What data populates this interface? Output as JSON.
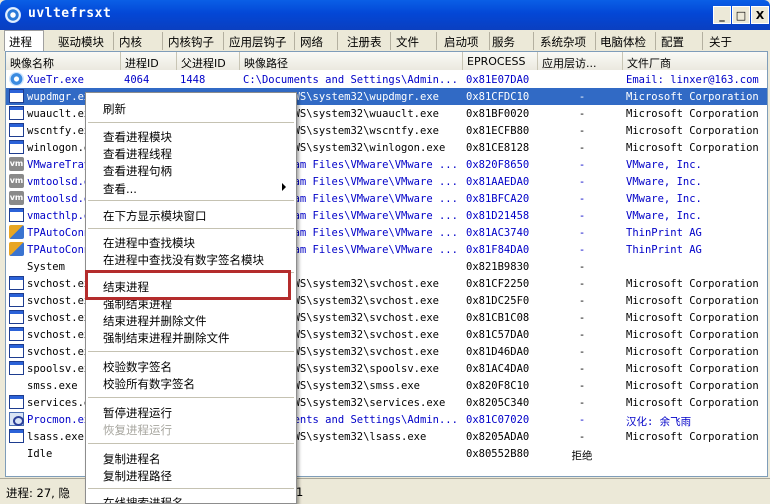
{
  "window": {
    "title": "uvltefrsxt",
    "minimize_label": "_",
    "maximize_label": "□",
    "close_label": "X"
  },
  "tabs": [
    "进程",
    "驱动模块",
    "内核",
    "内核钩子",
    "应用层钩子",
    "网络",
    "注册表",
    "文件",
    "启动项",
    "服务",
    "系统杂项",
    "电脑体检",
    "配置",
    "关于"
  ],
  "table": {
    "columns": [
      "映像名称",
      "进程ID",
      "父进程ID",
      "映像路径",
      "EPROCESS",
      "应用层访...",
      "文件厂商"
    ],
    "rows": [
      {
        "name": "XueTr.exe",
        "pid": "4064",
        "ppid": "1448",
        "path": "C:\\Documents and Settings\\Admin...",
        "eprocess": "0x81E07DA0",
        "access": "",
        "vendor": "Email: linxer@163.com",
        "icon": "xuetr-icon",
        "blue": true,
        "selected": false
      },
      {
        "name": "wupdmgr.exe",
        "pid": "",
        "ppid": "",
        "path": "C:\\WINDOWS\\system32\\wupdmgr.exe",
        "eprocess": "0x81CFDC10",
        "access": "-",
        "vendor": "Microsoft Corporation",
        "icon": "window-icon",
        "blue": false,
        "selected": true
      },
      {
        "name": "wuauclt.exe",
        "pid": "",
        "ppid": "",
        "path": "C:\\WINDOWS\\system32\\wuauclt.exe",
        "eprocess": "0x81BF0020",
        "access": "-",
        "vendor": "Microsoft Corporation",
        "icon": "window-icon",
        "blue": false,
        "selected": false
      },
      {
        "name": "wscntfy.exe",
        "pid": "",
        "ppid": "",
        "path": "C:\\WINDOWS\\system32\\wscntfy.exe",
        "eprocess": "0x81ECFB80",
        "access": "-",
        "vendor": "Microsoft Corporation",
        "icon": "window-icon",
        "blue": false,
        "selected": false
      },
      {
        "name": "winlogon.exe",
        "pid": "",
        "ppid": "",
        "path": "C:\\WINDOWS\\system32\\winlogon.exe",
        "eprocess": "0x81CE8128",
        "access": "-",
        "vendor": "Microsoft Corporation",
        "icon": "window-icon",
        "blue": false,
        "selected": false
      },
      {
        "name": "VMwareTray.exe",
        "pid": "",
        "ppid": "",
        "path": "C:\\Program Files\\VMware\\VMware ...",
        "eprocess": "0x820F8650",
        "access": "-",
        "vendor": "VMware, Inc.",
        "icon": "vm-icon",
        "blue": true,
        "selected": false
      },
      {
        "name": "vmtoolsd.exe",
        "pid": "",
        "ppid": "",
        "path": "C:\\Program Files\\VMware\\VMware ...",
        "eprocess": "0x81AAEDA0",
        "access": "-",
        "vendor": "VMware, Inc.",
        "icon": "vm-icon",
        "blue": true,
        "selected": false
      },
      {
        "name": "vmtoolsd.exe",
        "pid": "",
        "ppid": "",
        "path": "C:\\Program Files\\VMware\\VMware ...",
        "eprocess": "0x81BFCA20",
        "access": "-",
        "vendor": "VMware, Inc.",
        "icon": "vm-icon",
        "blue": true,
        "selected": false
      },
      {
        "name": "vmacthlp.exe",
        "pid": "",
        "ppid": "",
        "path": "C:\\Program Files\\VMware\\VMware ...",
        "eprocess": "0x81D21458",
        "access": "-",
        "vendor": "VMware, Inc.",
        "icon": "window-icon",
        "blue": true,
        "selected": false
      },
      {
        "name": "TPAutoConnSvc.exe",
        "pid": "",
        "ppid": "",
        "path": "C:\\Program Files\\VMware\\VMware ...",
        "eprocess": "0x81AC3740",
        "access": "-",
        "vendor": "ThinPrint AG",
        "icon": "thinprint-icon",
        "blue": true,
        "selected": false
      },
      {
        "name": "TPAutoConnect.exe",
        "pid": "",
        "ppid": "",
        "path": "C:\\Program Files\\VMware\\VMware ...",
        "eprocess": "0x81F84DA0",
        "access": "-",
        "vendor": "ThinPrint AG",
        "icon": "thinprint-icon",
        "blue": true,
        "selected": false
      },
      {
        "name": "System",
        "pid": "",
        "ppid": "",
        "path": "",
        "eprocess": "0x821B9830",
        "access": "-",
        "vendor": "",
        "icon": "blank-icon",
        "blue": false,
        "selected": false
      },
      {
        "name": "svchost.exe",
        "pid": "",
        "ppid": "",
        "path": "C:\\WINDOWS\\system32\\svchost.exe",
        "eprocess": "0x81CF2250",
        "access": "-",
        "vendor": "Microsoft Corporation",
        "icon": "window-icon",
        "blue": false,
        "selected": false
      },
      {
        "name": "svchost.exe",
        "pid": "",
        "ppid": "",
        "path": "C:\\WINDOWS\\system32\\svchost.exe",
        "eprocess": "0x81DC25F0",
        "access": "-",
        "vendor": "Microsoft Corporation",
        "icon": "window-icon",
        "blue": false,
        "selected": false
      },
      {
        "name": "svchost.exe",
        "pid": "",
        "ppid": "",
        "path": "C:\\WINDOWS\\system32\\svchost.exe",
        "eprocess": "0x81CB1C08",
        "access": "-",
        "vendor": "Microsoft Corporation",
        "icon": "window-icon",
        "blue": false,
        "selected": false
      },
      {
        "name": "svchost.exe",
        "pid": "",
        "ppid": "",
        "path": "C:\\WINDOWS\\system32\\svchost.exe",
        "eprocess": "0x81C57DA0",
        "access": "-",
        "vendor": "Microsoft Corporation",
        "icon": "window-icon",
        "blue": false,
        "selected": false
      },
      {
        "name": "svchost.exe",
        "pid": "",
        "ppid": "",
        "path": "C:\\WINDOWS\\system32\\svchost.exe",
        "eprocess": "0x81D46DA0",
        "access": "-",
        "vendor": "Microsoft Corporation",
        "icon": "window-icon",
        "blue": false,
        "selected": false
      },
      {
        "name": "spoolsv.exe",
        "pid": "",
        "ppid": "",
        "path": "C:\\WINDOWS\\system32\\spoolsv.exe",
        "eprocess": "0x81AC4DA0",
        "access": "-",
        "vendor": "Microsoft Corporation",
        "icon": "window-icon",
        "blue": false,
        "selected": false
      },
      {
        "name": "smss.exe",
        "pid": "",
        "ppid": "",
        "path": "C:\\WINDOWS\\system32\\smss.exe",
        "eprocess": "0x820F8C10",
        "access": "-",
        "vendor": "Microsoft Corporation",
        "icon": "blank-icon",
        "blue": false,
        "selected": false
      },
      {
        "name": "services.exe",
        "pid": "",
        "ppid": "",
        "path": "C:\\WINDOWS\\system32\\services.exe",
        "eprocess": "0x8205C340",
        "access": "-",
        "vendor": "Microsoft Corporation",
        "icon": "window-icon",
        "blue": false,
        "selected": false
      },
      {
        "name": "Procmon.exe",
        "pid": "",
        "ppid": "",
        "path": "C:\\Documents and Settings\\Admin...",
        "eprocess": "0x81C07020",
        "access": "-",
        "vendor": "汉化: 余飞雨",
        "icon": "procmon-icon",
        "blue": true,
        "selected": false
      },
      {
        "name": "lsass.exe",
        "pid": "",
        "ppid": "",
        "path": "C:\\WINDOWS\\system32\\lsass.exe",
        "eprocess": "0x8205ADA0",
        "access": "-",
        "vendor": "Microsoft Corporation",
        "icon": "window-icon",
        "blue": false,
        "selected": false
      },
      {
        "name": "Idle",
        "pid": "",
        "ppid": "",
        "path": "",
        "eprocess": "0x80552B80",
        "access": "拒绝",
        "vendor": "",
        "icon": "blank-icon",
        "blue": false,
        "selected": false
      }
    ],
    "visible_name_prefixes": [
      "XueTr.exe",
      "wupdmgr.ex",
      "wuauclt.ex",
      "wscntfy.ex",
      "winlogon.",
      "VMwareTray",
      "vmtoolsd.",
      "vmtoolsd.",
      "vmacthlp.",
      "TPAutoConn",
      "TPAutoConn",
      "System",
      "svchost.ex",
      "svchost.ex",
      "svchost.ex",
      "svchost.ex",
      "svchost.ex",
      "spoolsv.ex",
      "smss.exe",
      "services.",
      "Procmon.ex",
      "lsass.exe",
      "Idle"
    ],
    "visible_path_suffixes": [
      "C:\\Documents and Settings\\Admin...",
      "C:\\WINDOWS\\system32\\wupdmgr.exe",
      "S\\system32\\wuauclt.exe",
      "S\\system32\\wscntfy.exe",
      "S\\system32\\winlogon.exe",
      "m Files\\VMware\\VMware ...",
      "m Files\\VMware\\VMware ...",
      "m Files\\VMware\\VMware ...",
      "m Files\\VMware\\VMware ...",
      "m Files\\VMware\\VMware ...",
      "m Files\\VMware\\VMware ...",
      "",
      "S\\system32\\svchost.exe",
      "S\\system32\\svchost.exe",
      "S\\system32\\svchost.exe",
      "S\\system32\\svchost.exe",
      "S\\system32\\svchost.exe",
      "S\\system32\\spoolsv.exe",
      "S\\system32\\smss.exe",
      "S\\system32\\services.exe",
      "nts and Settings\\Admin...",
      "S\\system32\\lsass.exe",
      ""
    ]
  },
  "context_menu": {
    "items": [
      "刷新",
      "查看进程模块",
      "查看进程线程",
      "查看进程句柄",
      "查看...",
      "在下方显示模块窗口",
      "在进程中查找模块",
      "在进程中查找没有数字签名模块",
      "结束进程",
      "强制结束进程",
      "结束进程并删除文件",
      "强制结束进程并删除文件",
      "校验数字签名",
      "校验所有数字签名",
      "暂停进程运行",
      "恢复进程运行",
      "复制进程名",
      "复制进程路径",
      "在线搜索进程名"
    ],
    "disabled": [
      "恢复进程运行"
    ],
    "highlighted": "结束进程"
  },
  "status": {
    "text": "进程: 27, 隐",
    "tail": "1"
  },
  "colors": {
    "selection": "#316ac5",
    "highlight_border": "#b42c2c",
    "title_bar": "#0347d6",
    "link_blue": "#0000c8"
  }
}
